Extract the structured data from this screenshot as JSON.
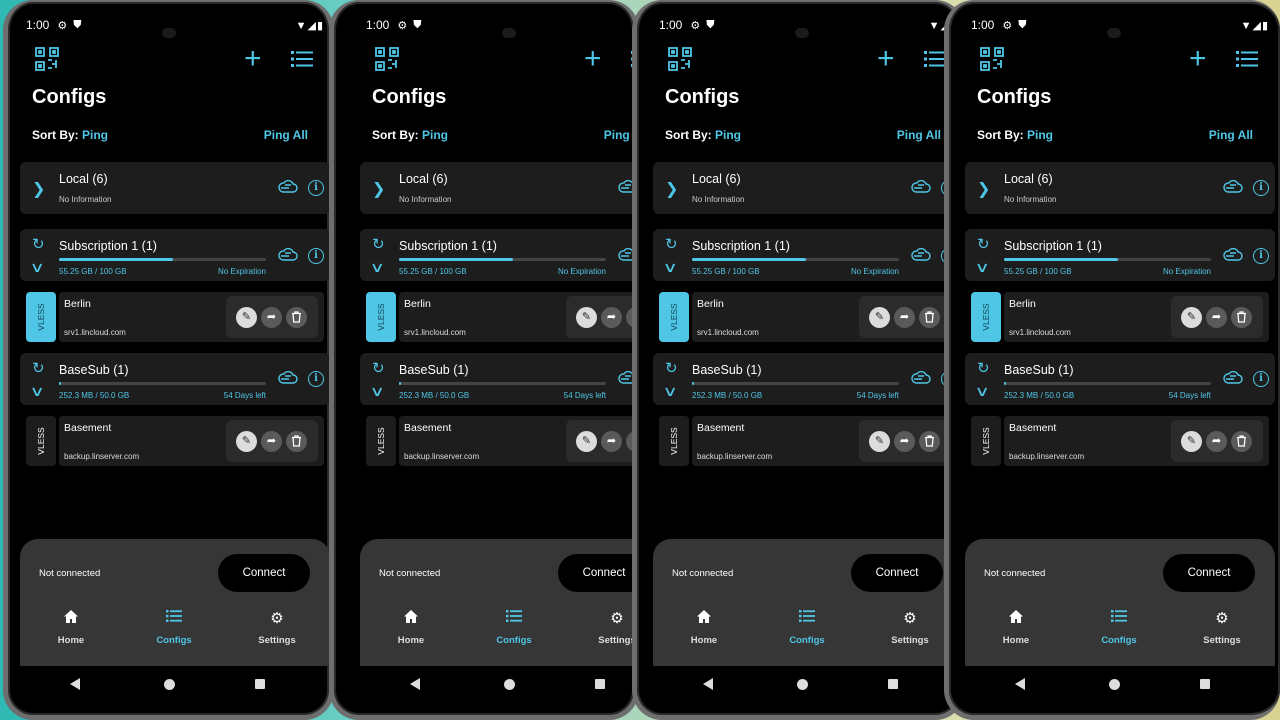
{
  "statusbar": {
    "time": "1:00",
    "gear": "⚙",
    "shield": "⛊",
    "signal": "▼◢▮"
  },
  "header": {
    "title": "Configs",
    "add_glyph": "+",
    "sort_label": "Sort By:",
    "sort_value": "Ping",
    "ping_all": "Ping All"
  },
  "groups": [
    {
      "name": "Local (6)",
      "info": "No Information"
    },
    {
      "name": "Subscription 1 (1)",
      "usage": "55.25 GB / 100 GB",
      "expiry": "No Expiration",
      "progress": 0.5525
    },
    {
      "name": "BaseSub (1)",
      "usage": "252.3 MB / 50.0 GB",
      "expiry": "54 Days left",
      "progress": 0.005
    }
  ],
  "servers": [
    {
      "protocol": "VLESS",
      "name": "Berlin",
      "host": "srv1.lincloud.com",
      "active": true
    },
    {
      "protocol": "VLESS",
      "name": "Basement",
      "host": "backup.linserver.com",
      "active": false
    }
  ],
  "sheet": {
    "status": "Not connected",
    "connect": "Connect"
  },
  "nav": [
    {
      "label": "Home",
      "icon": "home-icon",
      "active": false
    },
    {
      "label": "Configs",
      "icon": "list-icon",
      "active": true
    },
    {
      "label": "Settings",
      "icon": "gear-icon",
      "active": false
    }
  ],
  "glyphs": {
    "chevron_right": "❯",
    "chevron_down": "∨",
    "sync": "↻",
    "info": "i",
    "edit": "✎",
    "share": "➦",
    "delete": "🗑",
    "home": "⌂",
    "list": "☰",
    "gear": "⚙"
  },
  "colors": {
    "accent": "#4fc6e6",
    "card": "#1d1d1d",
    "sheet": "#363636"
  }
}
